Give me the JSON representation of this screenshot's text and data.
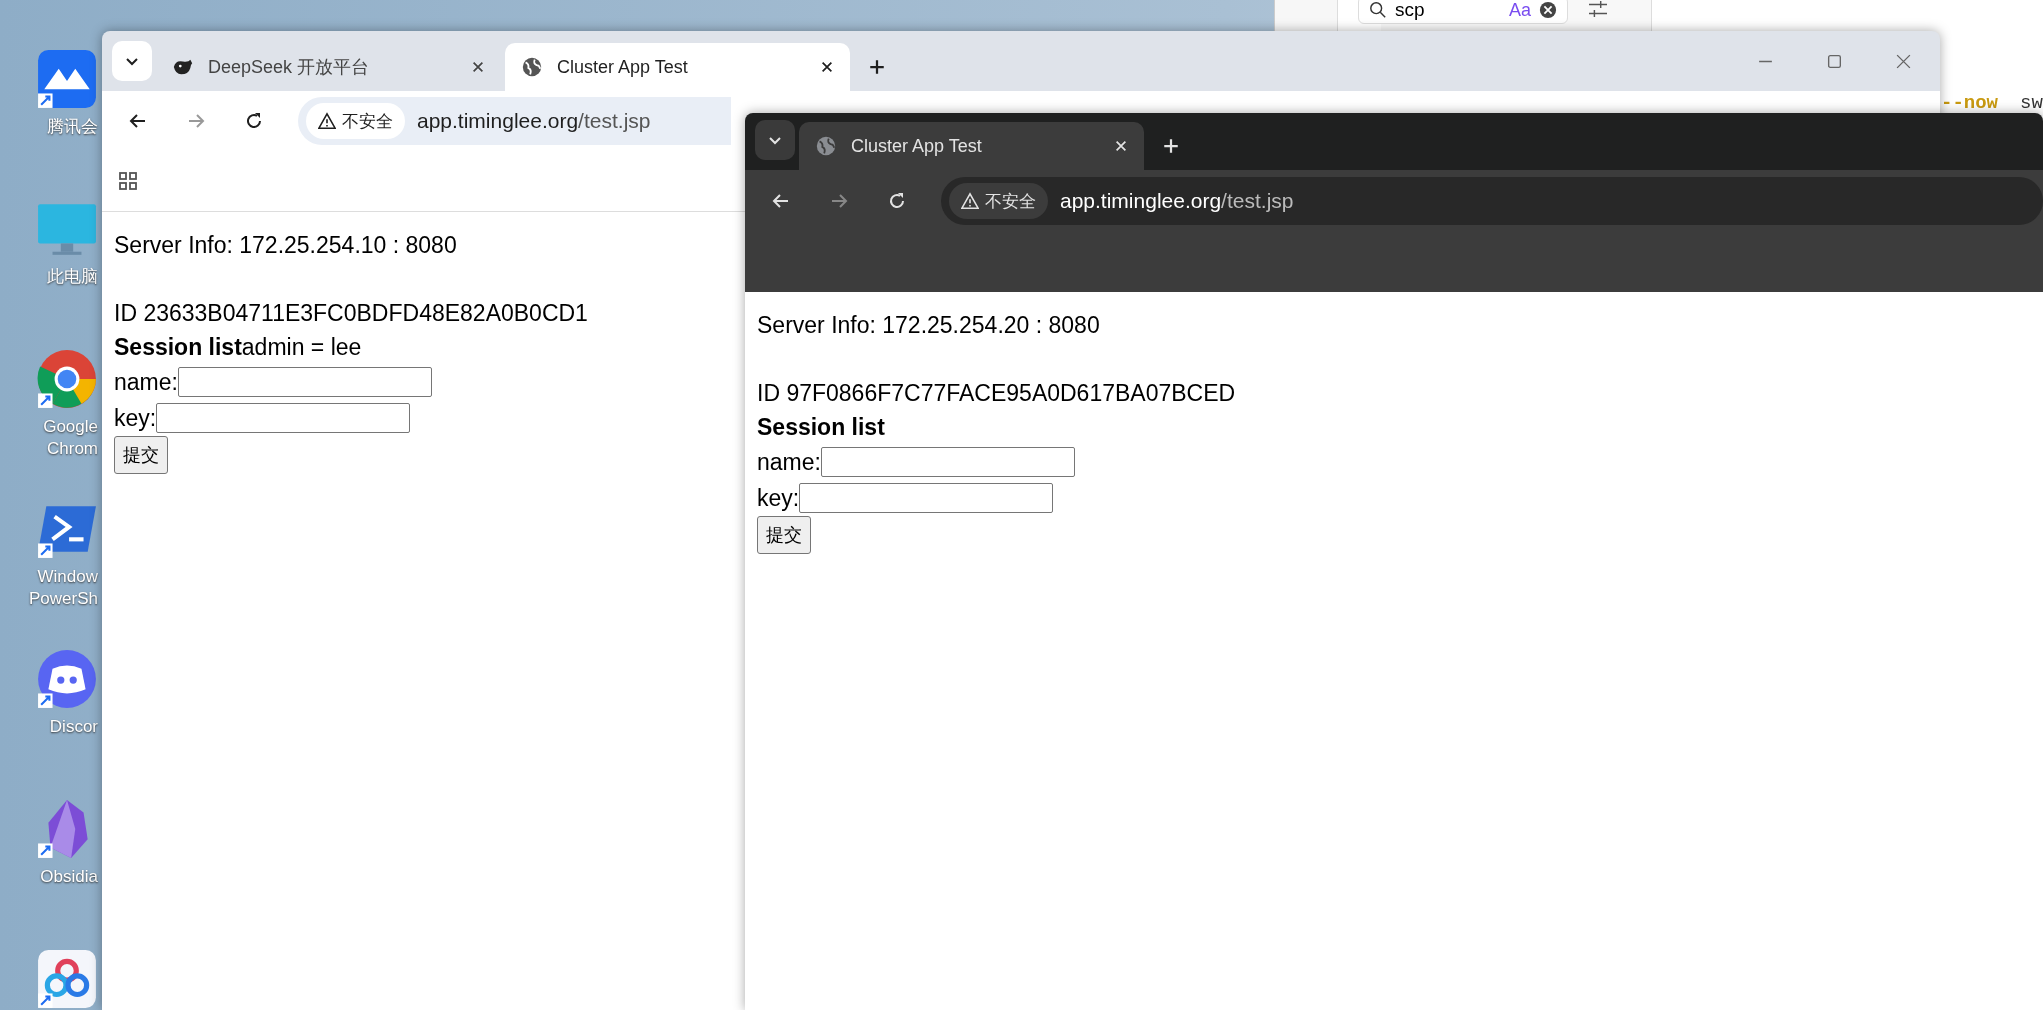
{
  "desktop_icons": [
    {
      "kind": "meeting",
      "lines": [
        "腾讯会"
      ]
    },
    {
      "kind": "computer",
      "lines": [
        "此电脑"
      ]
    },
    {
      "kind": "chrome",
      "lines": [
        "Google",
        "Chrom"
      ]
    },
    {
      "kind": "powershell",
      "lines": [
        "Window",
        "PowerSh"
      ]
    },
    {
      "kind": "discord",
      "lines": [
        "Discor"
      ]
    },
    {
      "kind": "obsidian",
      "lines": [
        "Obsidia"
      ]
    },
    {
      "kind": "app"
    }
  ],
  "editor": {
    "search": {
      "value": "scp",
      "option": "Aa"
    },
    "code": [
      {
        "text": "--now",
        "kind": "flag"
      },
      {
        "text": "sw",
        "kind": "plain"
      }
    ]
  },
  "windows": [
    {
      "can_go_forward": false,
      "tabs": [
        {
          "title": "DeepSeek 开放平台",
          "kind": "whale",
          "selected": false
        },
        {
          "title": "Cluster App Test",
          "kind": "globe",
          "selected": true
        }
      ],
      "address": {
        "security": "不安全",
        "host": "app.timinglee.org",
        "path": "/test.jsp"
      },
      "page": {
        "server_info": "Server Info: 172.25.254.10 : 8080",
        "session_id": "ID 23633B04711E3FC0BDFD48E82A0B0CD1",
        "session_list": "**Session list**admin = lee",
        "fields": [
          {
            "label": "name:"
          },
          {
            "label": "key:"
          }
        ],
        "submit": "提交"
      }
    },
    {
      "can_go_forward": false,
      "tabs": [
        {
          "title": "Cluster App Test",
          "kind": "globe",
          "selected": true
        }
      ],
      "address": {
        "security": "不安全",
        "host": "app.timinglee.org",
        "path": "/test.jsp"
      },
      "page": {
        "server_info": "Server Info: 172.25.254.20 : 8080",
        "session_id": "ID 97F0866F7C77FACE95A0D617BA07BCED",
        "session_list": "**Session list**",
        "fields": [
          {
            "label": "name:"
          },
          {
            "label": "key:"
          }
        ],
        "submit": "提交"
      }
    }
  ]
}
